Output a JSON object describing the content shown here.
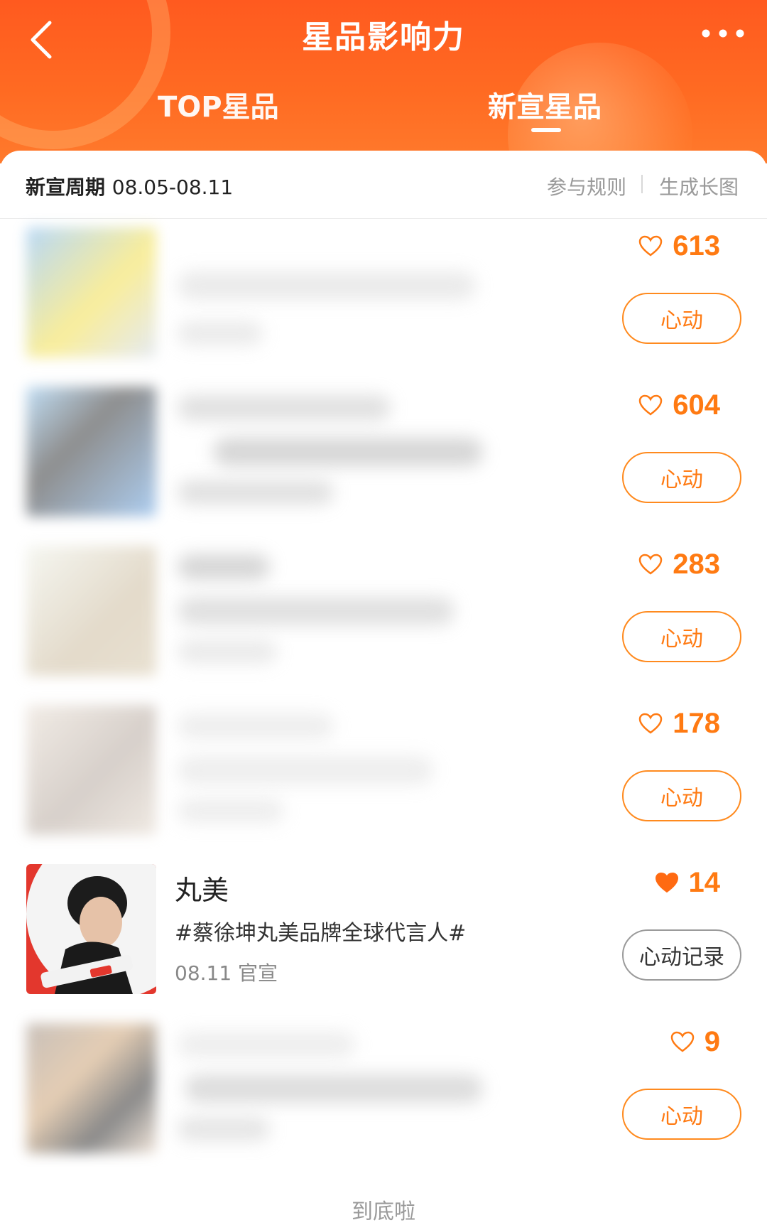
{
  "header": {
    "title": "星品影响力",
    "tabs": [
      {
        "label": "TOP星品",
        "active": false
      },
      {
        "label": "新宣星品",
        "active": true
      }
    ],
    "accent_color": "#ff6a22"
  },
  "period": {
    "label": "新宣周期",
    "range": "08.05-08.11",
    "rules_link": "参与规则",
    "generate_link": "生成长图"
  },
  "items": [
    {
      "name": "",
      "tag": "",
      "date": "",
      "likes": "613",
      "liked": false,
      "button": "心动"
    },
    {
      "name": "",
      "tag": "",
      "date": "",
      "likes": "604",
      "liked": false,
      "button": "心动"
    },
    {
      "name": "",
      "tag": "",
      "date": "",
      "likes": "283",
      "liked": false,
      "button": "心动"
    },
    {
      "name": "",
      "tag": "",
      "date": "",
      "likes": "178",
      "liked": false,
      "button": "心动"
    },
    {
      "name": "丸美",
      "tag": "#蔡徐坤丸美品牌全球代言人#",
      "date": "08.11 官宣",
      "likes": "14",
      "liked": true,
      "button": "心动记录"
    },
    {
      "name": "",
      "tag": "",
      "date": "",
      "likes": "9",
      "liked": false,
      "button": "心动"
    }
  ],
  "footer": {
    "text": "到底啦"
  },
  "colors": {
    "like_orange": "#ff7a12",
    "button_border": "#ff8a1e"
  }
}
